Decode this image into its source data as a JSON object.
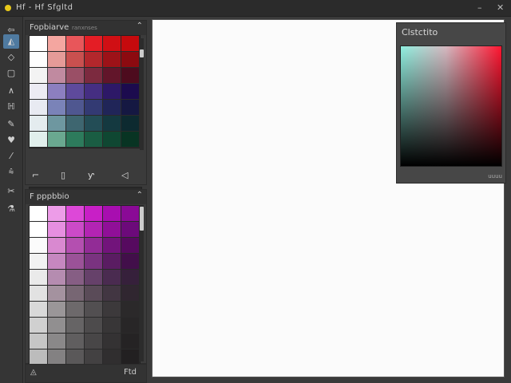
{
  "window": {
    "title": "Hf - Hf Sfgltd",
    "controls": [
      "–",
      "✕"
    ]
  },
  "toolbar": {
    "tools": [
      "arrow-tool-icon",
      "brush-tool-icon",
      "fill-tool-icon",
      "selection-tool-icon",
      "line-tool-icon",
      "text-tool-icon",
      "eraser-tool-icon",
      "heart-tool-icon",
      "pen-tool-icon",
      "move-tool-icon",
      "cut-tool-icon",
      "flask-tool-icon"
    ],
    "glyphs": [
      "⇦",
      "◭",
      "◇",
      "▢",
      "∧",
      "ℍ",
      "✎",
      "♥",
      "⁄",
      "⩯",
      "✂",
      "⚗"
    ],
    "active_index": 1
  },
  "palette_top": {
    "title": "Fopbiarve",
    "subtitle": "ranxnses",
    "collapse_glyph": "⌃",
    "colors": [
      [
        "#ffffff",
        "#f4a6a0",
        "#e8565a",
        "#e41d25",
        "#d00f14",
        "#c60a0d"
      ],
      [
        "#fdfdfd",
        "#e59b98",
        "#c9504f",
        "#b3272c",
        "#9d1218",
        "#8c0a10"
      ],
      [
        "#f3f3f3",
        "#c08aa0",
        "#9a4f66",
        "#7c2a3f",
        "#62152a",
        "#4d0b1e"
      ],
      [
        "#ecebf3",
        "#8c7fc0",
        "#5e4a9c",
        "#452e82",
        "#2d1867",
        "#1c0b4e"
      ],
      [
        "#e8eaf2",
        "#7a83b8",
        "#4f5790",
        "#333a73",
        "#202558",
        "#151842"
      ],
      [
        "#e4ecef",
        "#6e97a0",
        "#3e6670",
        "#234d56",
        "#143940",
        "#0d2a30"
      ],
      [
        "#e1efec",
        "#6aa890",
        "#2d7b5c",
        "#1a5d43",
        "#0f4732",
        "#083423"
      ]
    ],
    "icons": [
      "frame-icon",
      "page-icon",
      "pin-icon",
      "speaker-icon"
    ],
    "icon_glyphs": [
      "⌐",
      "▯",
      "ƴ",
      "◁"
    ],
    "input_value": "",
    "input_icon": "▲",
    "input_button": "⌕"
  },
  "palette_bottom": {
    "title": "F pppbbio",
    "collapse_glyph": "⌃",
    "colors": [
      [
        "#ffffff",
        "#ed9ce8",
        "#dd48d8",
        "#c81fc6",
        "#a80eb0",
        "#8a0a96"
      ],
      [
        "#ffffff",
        "#e68fe0",
        "#cc4ac8",
        "#b324b3",
        "#900f98",
        "#6c0a7a"
      ],
      [
        "#fbfbfb",
        "#d989d0",
        "#b44fb0",
        "#922c96",
        "#72147b",
        "#560a5f"
      ],
      [
        "#f2f2f2",
        "#c687c0",
        "#9b5298",
        "#7a3380",
        "#5a1c62",
        "#420f4a"
      ],
      [
        "#eaeaea",
        "#b58cb0",
        "#865e84",
        "#66416a",
        "#4a2b50",
        "#36203b"
      ],
      [
        "#e2e2e2",
        "#a4929f",
        "#776673",
        "#5a4b58",
        "#423642",
        "#302630"
      ],
      [
        "#d9d9d9",
        "#9a9698",
        "#6d696b",
        "#524f51",
        "#3c393b",
        "#2b292a"
      ],
      [
        "#d0d0d0",
        "#918f90",
        "#666465",
        "#4d4b4c",
        "#383637",
        "#282627"
      ],
      [
        "#c6c6c6",
        "#8a8889",
        "#605e5f",
        "#484647",
        "#343233",
        "#252324"
      ],
      [
        "#bcbcbc",
        "#838182",
        "#5a5859",
        "#434142",
        "#302e2f",
        "#222021"
      ]
    ],
    "foot_icon": "◬",
    "foot_label": "Ftd"
  },
  "color_picker": {
    "title": "Clstctito",
    "footer": "uuuu"
  }
}
